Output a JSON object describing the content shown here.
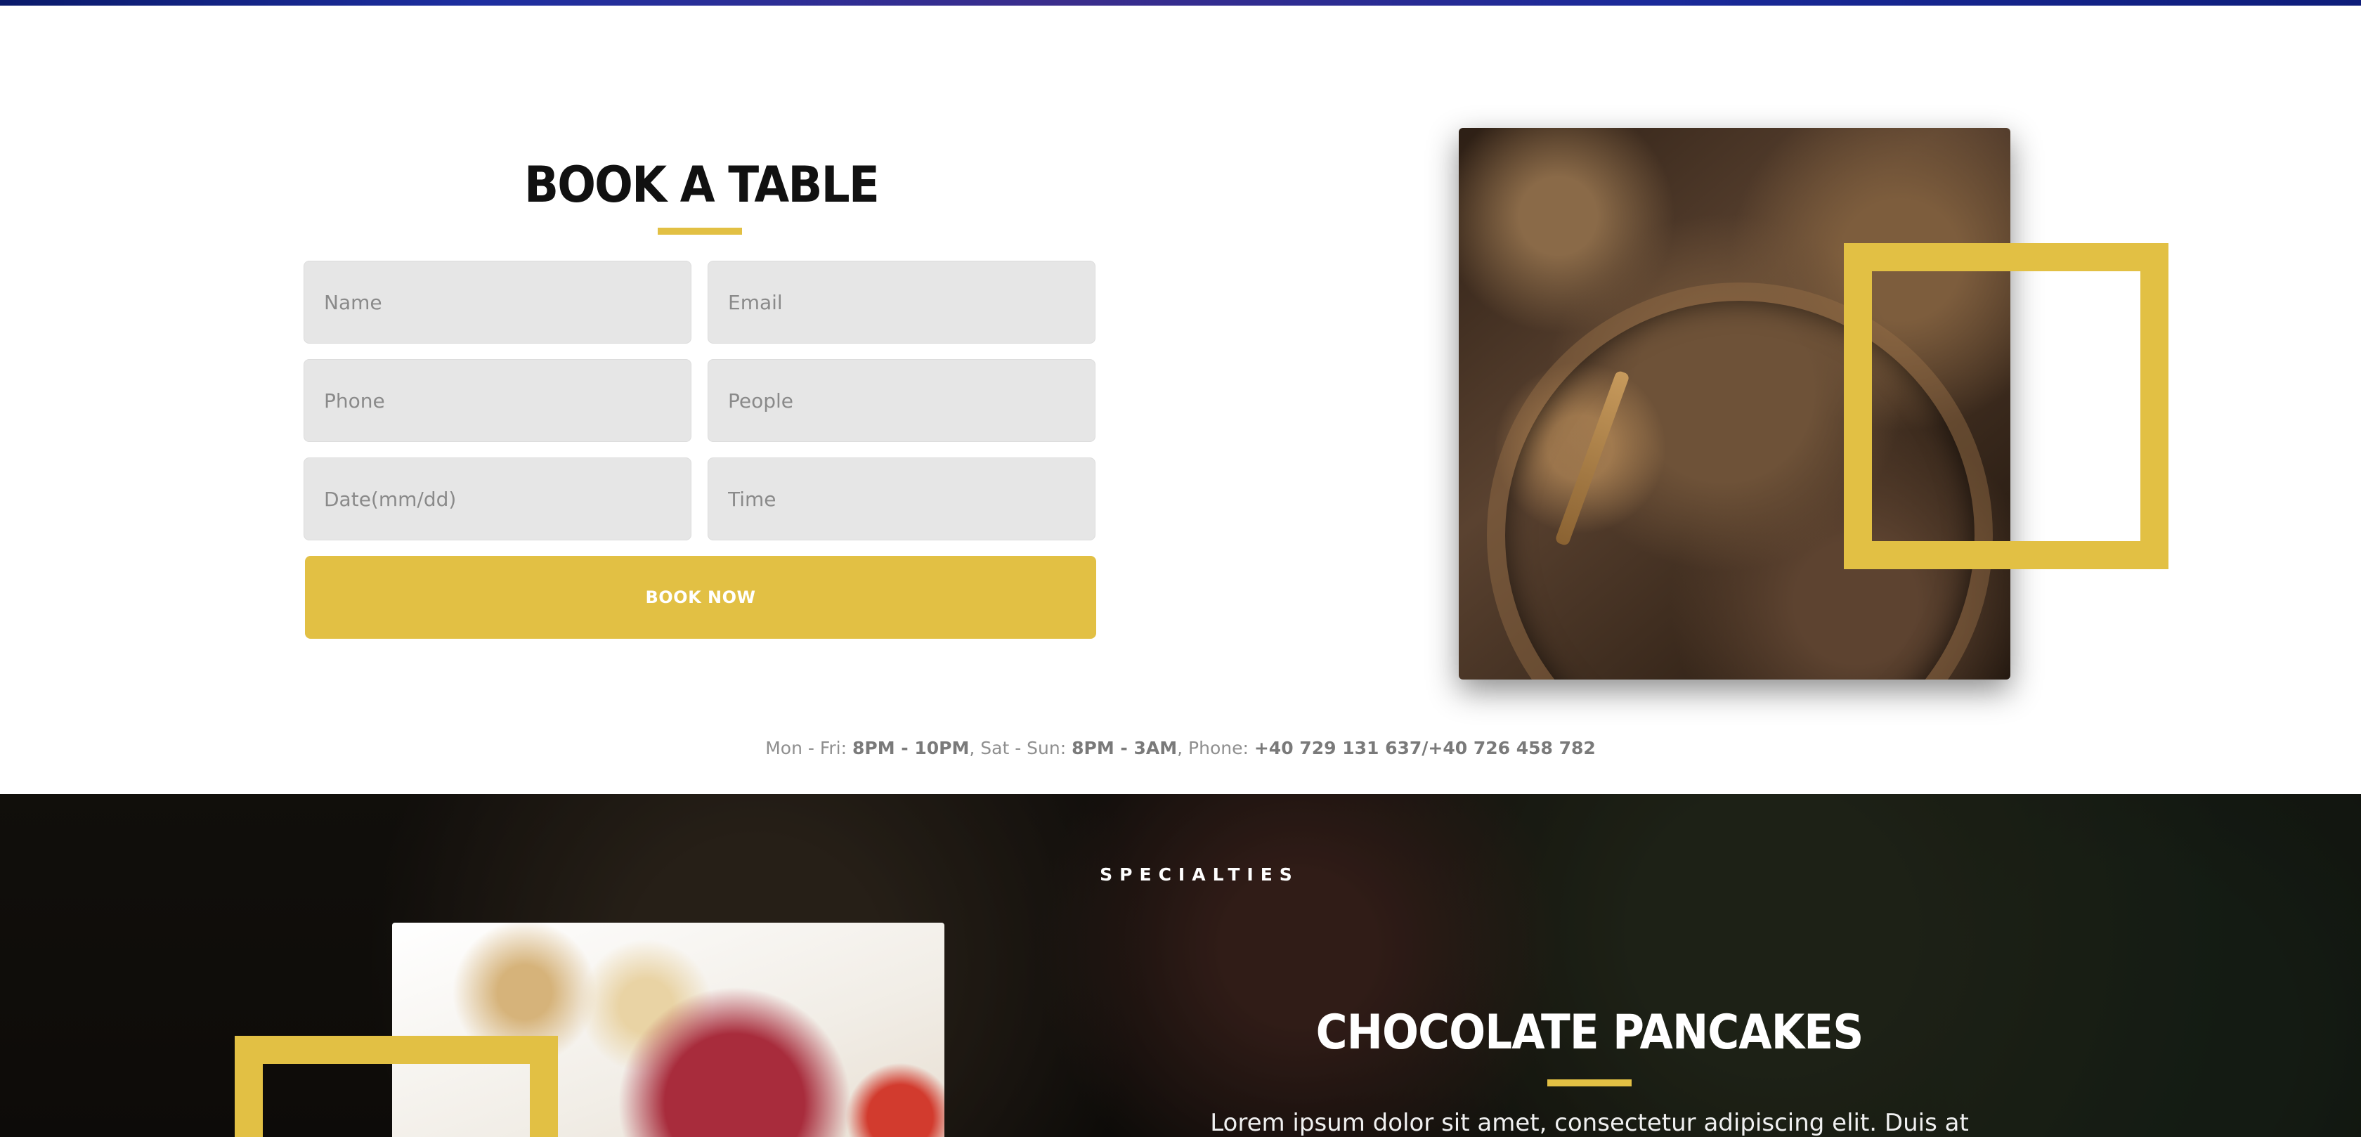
{
  "booking": {
    "title": "BOOK A TABLE",
    "fields": {
      "name_placeholder": "Name",
      "email_placeholder": "Email",
      "phone_placeholder": "Phone",
      "people_placeholder": "People",
      "date_placeholder": "Date(mm/dd)",
      "time_placeholder": "Time"
    },
    "submit_label": "BOOK NOW",
    "image": "clock-photo"
  },
  "hours": {
    "weekday_label": "Mon - Fri:",
    "weekday_hours": "8PM - 10PM",
    "weekend_label": "Sat - Sun:",
    "weekend_hours": "8PM - 3AM",
    "phone_label": "Phone:",
    "phone_numbers": "+40 729 131 637/+40 726 458 782"
  },
  "specialties": {
    "label": "SPECIALTIES",
    "dish_title": "CHOCOLATE PANCAKES",
    "dish_text": "Lorem ipsum dolor sit amet, consectetur adipiscing elit. Duis at",
    "image": "dessert-photo"
  },
  "colors": {
    "accent": "#e2c044",
    "field_bg": "#e6e6e6",
    "dark_bg": "#16120e"
  }
}
